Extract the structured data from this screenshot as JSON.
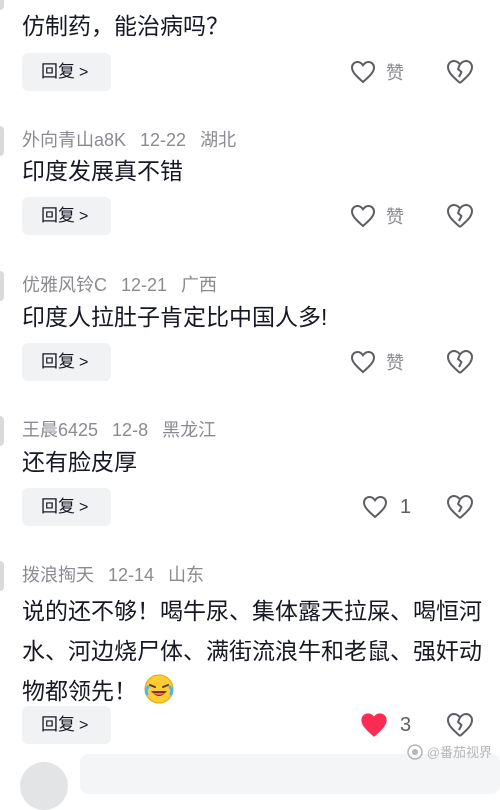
{
  "comments": [
    {
      "text": "仿制药，能治病吗？",
      "reply_label": "回复",
      "like_label": "赞"
    },
    {
      "username": "外向青山a8K",
      "date": "12-22",
      "location": "湖北",
      "text": "印度发展真不错",
      "reply_label": "回复",
      "like_label": "赞"
    },
    {
      "username": "优雅风铃C",
      "date": "12-21",
      "location": "广西",
      "text": "印度人拉肚子肯定比中国人多!",
      "reply_label": "回复",
      "like_label": "赞"
    },
    {
      "username": "王晨6425",
      "date": "12-8",
      "location": "黑龙江",
      "text": "还有脸皮厚",
      "reply_label": "回复",
      "like_count": "1"
    },
    {
      "username": "拨浪掏天",
      "date": "12-14",
      "location": "山东",
      "text": "说的还不够！喝牛尿、集体露天拉屎、喝恒河水、河边烧尸体、满街流浪牛和老鼠、强奸动物都领先！",
      "reply_label": "回复",
      "like_count": "3",
      "liked": true
    }
  ],
  "watermark": "@番茄视界",
  "colors": {
    "text": "#161823",
    "meta": "#8a8b91",
    "reply_bg": "#f1f2f4",
    "liked_heart": "#fe2c55"
  }
}
